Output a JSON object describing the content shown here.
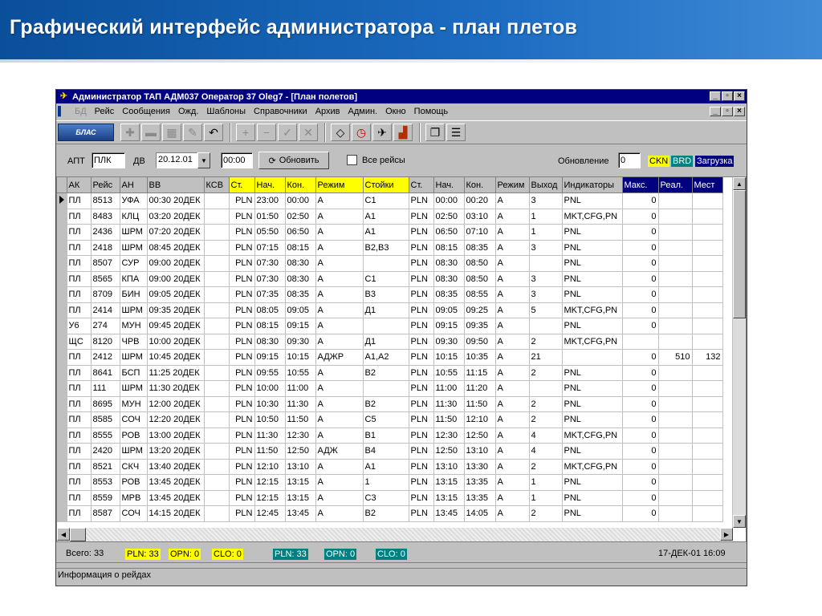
{
  "slide": {
    "title": "Графический интерфейс администратора - план плетов"
  },
  "window": {
    "title": "Администратор ТАП АДМ037 Оператор 37 Oleg7 - [План полетов]",
    "menu": [
      "БД",
      "Рейс",
      "Сообщения",
      "Ожд.",
      "Шаблоны",
      "Справочники",
      "Архив",
      "Админ.",
      "Окно",
      "Помощь"
    ],
    "logo_text": "БЛАС"
  },
  "filters": {
    "apt_label": "АПТ",
    "apt_value": "ПЛК",
    "dv_label": "ДВ",
    "date_value": "20.12.01",
    "time_value": "00:00",
    "refresh_label": "Обновить",
    "all_flights_label": "Все рейсы",
    "update_label": "Обновление",
    "update_value": "0",
    "badge_ckn": "CKN",
    "badge_brd": "BRD",
    "badge_load": "Загрузка"
  },
  "table": {
    "headers": [
      "АК",
      "Рейс",
      "АН",
      "ВВ",
      "КСВ",
      "Ст.",
      "Нач.",
      "Кон.",
      "Режим",
      "Стойки",
      "Ст.",
      "Нач.",
      "Кон.",
      "Режим",
      "Выход",
      "Индикаторы",
      "Макс.",
      "Реал.",
      "Мест"
    ],
    "rows": [
      [
        "ПЛ",
        "8513",
        "УФА",
        "00:30 20ДЕК",
        "",
        "PLN",
        "23:00",
        "00:00",
        "А",
        "С1",
        "PLN",
        "00:00",
        "00:20",
        "А",
        "3",
        "PNL",
        "0",
        "",
        ""
      ],
      [
        "ПЛ",
        "8483",
        "КЛЦ",
        "03:20 20ДЕК",
        "",
        "PLN",
        "01:50",
        "02:50",
        "А",
        "А1",
        "PLN",
        "02:50",
        "03:10",
        "А",
        "1",
        "MKT,CFG,PN",
        "0",
        "",
        ""
      ],
      [
        "ПЛ",
        "2436",
        "ШРМ",
        "07:20 20ДЕК",
        "",
        "PLN",
        "05:50",
        "06:50",
        "А",
        "А1",
        "PLN",
        "06:50",
        "07:10",
        "А",
        "1",
        "PNL",
        "0",
        "",
        ""
      ],
      [
        "ПЛ",
        "2418",
        "ШРМ",
        "08:45 20ДЕК",
        "",
        "PLN",
        "07:15",
        "08:15",
        "А",
        "В2,В3",
        "PLN",
        "08:15",
        "08:35",
        "А",
        "3",
        "PNL",
        "0",
        "",
        ""
      ],
      [
        "ПЛ",
        "8507",
        "СУР",
        "09:00 20ДЕК",
        "",
        "PLN",
        "07:30",
        "08:30",
        "А",
        "",
        "PLN",
        "08:30",
        "08:50",
        "А",
        "",
        "PNL",
        "0",
        "",
        ""
      ],
      [
        "ПЛ",
        "8565",
        "КПА",
        "09:00 20ДЕК",
        "",
        "PLN",
        "07:30",
        "08:30",
        "А",
        "С1",
        "PLN",
        "08:30",
        "08:50",
        "А",
        "3",
        "PNL",
        "0",
        "",
        ""
      ],
      [
        "ПЛ",
        "8709",
        "БИН",
        "09:05 20ДЕК",
        "",
        "PLN",
        "07:35",
        "08:35",
        "А",
        "В3",
        "PLN",
        "08:35",
        "08:55",
        "А",
        "3",
        "PNL",
        "0",
        "",
        ""
      ],
      [
        "ПЛ",
        "2414",
        "ШРМ",
        "09:35 20ДЕК",
        "",
        "PLN",
        "08:05",
        "09:05",
        "А",
        "Д1",
        "PLN",
        "09:05",
        "09:25",
        "А",
        "5",
        "MKT,CFG,PN",
        "0",
        "",
        ""
      ],
      [
        "У6",
        "274",
        "МУН",
        "09:45 20ДЕК",
        "",
        "PLN",
        "08:15",
        "09:15",
        "А",
        "",
        "PLN",
        "09:15",
        "09:35",
        "А",
        "",
        "PNL",
        "0",
        "",
        ""
      ],
      [
        "ЩС",
        "8120",
        "ЧРВ",
        "10:00 20ДЕК",
        "",
        "PLN",
        "08:30",
        "09:30",
        "А",
        "Д1",
        "PLN",
        "09:30",
        "09:50",
        "А",
        "2",
        "MKT,CFG,PN",
        "",
        "",
        ""
      ],
      [
        "ПЛ",
        "2412",
        "ШРМ",
        "10:45 20ДЕК",
        "",
        "PLN",
        "09:15",
        "10:15",
        "АДЖР",
        "А1,А2",
        "PLN",
        "10:15",
        "10:35",
        "А",
        "21",
        "",
        "0",
        "510",
        "132"
      ],
      [
        "ПЛ",
        "8641",
        "БСП",
        "11:25 20ДЕК",
        "",
        "PLN",
        "09:55",
        "10:55",
        "А",
        "В2",
        "PLN",
        "10:55",
        "11:15",
        "А",
        "2",
        "PNL",
        "0",
        "",
        ""
      ],
      [
        "ПЛ",
        "111",
        "ШРМ",
        "11:30 20ДЕК",
        "",
        "PLN",
        "10:00",
        "11:00",
        "А",
        "",
        "PLN",
        "11:00",
        "11:20",
        "А",
        "",
        "PNL",
        "0",
        "",
        ""
      ],
      [
        "ПЛ",
        "8695",
        "МУН",
        "12:00 20ДЕК",
        "",
        "PLN",
        "10:30",
        "11:30",
        "А",
        "В2",
        "PLN",
        "11:30",
        "11:50",
        "А",
        "2",
        "PNL",
        "0",
        "",
        ""
      ],
      [
        "ПЛ",
        "8585",
        "СОЧ",
        "12:20 20ДЕК",
        "",
        "PLN",
        "10:50",
        "11:50",
        "А",
        "С5",
        "PLN",
        "11:50",
        "12:10",
        "А",
        "2",
        "PNL",
        "0",
        "",
        ""
      ],
      [
        "ПЛ",
        "8555",
        "РОВ",
        "13:00 20ДЕК",
        "",
        "PLN",
        "11:30",
        "12:30",
        "А",
        "В1",
        "PLN",
        "12:30",
        "12:50",
        "А",
        "4",
        "MKT,CFG,PN",
        "0",
        "",
        ""
      ],
      [
        "ПЛ",
        "2420",
        "ШРМ",
        "13:20 20ДЕК",
        "",
        "PLN",
        "11:50",
        "12:50",
        "АДЖ",
        "В4",
        "PLN",
        "12:50",
        "13:10",
        "А",
        "4",
        "PNL",
        "0",
        "",
        ""
      ],
      [
        "ПЛ",
        "8521",
        "СКЧ",
        "13:40 20ДЕК",
        "",
        "PLN",
        "12:10",
        "13:10",
        "А",
        "А1",
        "PLN",
        "13:10",
        "13:30",
        "А",
        "2",
        "MKT,CFG,PN",
        "0",
        "",
        ""
      ],
      [
        "ПЛ",
        "8553",
        "РОВ",
        "13:45 20ДЕК",
        "",
        "PLN",
        "12:15",
        "13:15",
        "А",
        "1",
        "PLN",
        "13:15",
        "13:35",
        "А",
        "1",
        "PNL",
        "0",
        "",
        ""
      ],
      [
        "ПЛ",
        "8559",
        "МРВ",
        "13:45 20ДЕК",
        "",
        "PLN",
        "12:15",
        "13:15",
        "А",
        "С3",
        "PLN",
        "13:15",
        "13:35",
        "А",
        "1",
        "PNL",
        "0",
        "",
        ""
      ],
      [
        "ПЛ",
        "8587",
        "СОЧ",
        "14:15 20ДЕК",
        "",
        "PLN",
        "12:45",
        "13:45",
        "А",
        "В2",
        "PLN",
        "13:45",
        "14:05",
        "А",
        "2",
        "PNL",
        "0",
        "",
        ""
      ]
    ]
  },
  "status": {
    "total": "Всего: 33",
    "pln1": "PLN: 33",
    "opn1": "OPN: 0",
    "clo1": "CLO: 0",
    "pln2": "PLN: 33",
    "opn2": "OPN: 0",
    "clo2": "CLO: 0",
    "datetime": "17-ДЕК-01 16:09",
    "info": "Информация о рейдах"
  },
  "colors": {
    "header_blue": "#0a4f9a",
    "titlebar": "#000080",
    "highlight_yellow": "#ffff00",
    "teal": "#008080"
  }
}
